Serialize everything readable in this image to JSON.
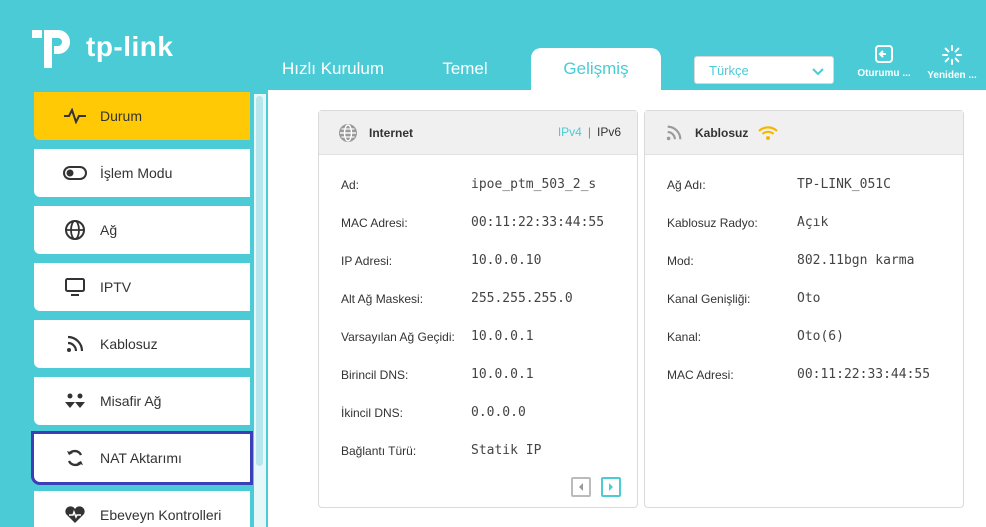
{
  "brand": {
    "name": "tp-link"
  },
  "tabs": [
    {
      "label": "Hızlı Kurulum"
    },
    {
      "label": "Temel"
    },
    {
      "label": "Gelişmiş"
    }
  ],
  "language": {
    "selected": "Türkçe"
  },
  "header_buttons": {
    "logout": "Oturumu ...",
    "reboot": "Yeniden ..."
  },
  "sidebar": {
    "items": [
      {
        "label": "Durum",
        "icon": "pulse-icon"
      },
      {
        "label": "İşlem Modu",
        "icon": "toggle-icon"
      },
      {
        "label": "Ağ",
        "icon": "globe-icon"
      },
      {
        "label": "IPTV",
        "icon": "monitor-icon"
      },
      {
        "label": "Kablosuz",
        "icon": "wifi-signal-icon"
      },
      {
        "label": "Misafir Ağ",
        "icon": "guest-icon"
      },
      {
        "label": "NAT Aktarımı",
        "icon": "nat-refresh-icon"
      },
      {
        "label": "Ebeveyn Kontrolleri",
        "icon": "heart-icon"
      }
    ]
  },
  "internet": {
    "title": "Internet",
    "ipv4": "IPv4",
    "sep": "|",
    "ipv6": "IPv6",
    "rows": [
      {
        "label": "Ad:",
        "value": "ipoe_ptm_503_2_s"
      },
      {
        "label": "MAC Adresi:",
        "value": "00:11:22:33:44:55"
      },
      {
        "label": "IP Adresi:",
        "value": "10.0.0.10"
      },
      {
        "label": "Alt Ağ Maskesi:",
        "value": "255.255.255.0"
      },
      {
        "label": "Varsayılan Ağ Geçidi:",
        "value": "10.0.0.1"
      },
      {
        "label": "Birincil DNS:",
        "value": "10.0.0.1"
      },
      {
        "label": "İkincil DNS:",
        "value": "0.0.0.0"
      },
      {
        "label": "Bağlantı Türü:",
        "value": "Statik IP"
      }
    ]
  },
  "wireless": {
    "title": "Kablosuz",
    "rows": [
      {
        "label": "Ağ Adı:",
        "value": "TP-LINK_051C"
      },
      {
        "label": "Kablosuz Radyo:",
        "value": "Açık"
      },
      {
        "label": "Mod:",
        "value": "802.11bgn karma"
      },
      {
        "label": "Kanal Genişliği:",
        "value": "Oto"
      },
      {
        "label": "Kanal:",
        "value": "Oto(6)"
      },
      {
        "label": "MAC Adresi:",
        "value": "00:11:22:33:44:55"
      }
    ]
  },
  "colors": {
    "accent": "#4acbd6",
    "active": "#ffc905",
    "highlight": "#3a3fb7",
    "wifi": "#f5b800"
  }
}
